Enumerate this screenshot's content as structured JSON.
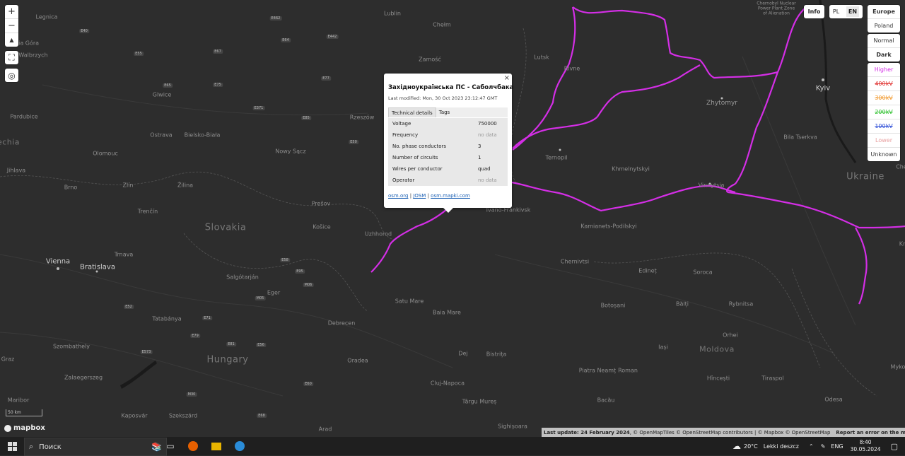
{
  "map": {
    "countries": {
      "slovakia": "Slovakia",
      "hungary": "Hungary",
      "ukraine": "Ukraine",
      "moldova": "Moldova",
      "czechia": "echia"
    },
    "cities": {
      "legnica": "Legnica",
      "walbrzych": "Walbrzych",
      "jelenia": "elenia Góra",
      "lublin": "Lublin",
      "chelm": "Chełm",
      "zamosc": "Zamość",
      "lutsk": "Lutsk",
      "rivne": "Rivne",
      "kyiv": "Kyiv",
      "zhytomyr": "Zhytomyr",
      "bila": "Bila Tserkva",
      "ternopil": "Ternopil",
      "khmel": "Khmelnytskyi",
      "vinnytsia": "Vinnytsia",
      "ivano": "Ivano-Frankivsk",
      "kamianets": "Kamianets-Podilskyi",
      "chernivtsi": "Chernivtsi",
      "edinet": "Edineț",
      "soroca": "Soroca",
      "balti": "Bălți",
      "rybnitsa": "Rybnitsa",
      "botosani": "Botoșani",
      "orhei": "Orhei",
      "iasi": "Iași",
      "hincesti": "Hîncești",
      "tiraspol": "Tiraspol",
      "odesa": "Odesa",
      "piatra": "Piatra Neamț",
      "roman": "Roman",
      "bacau": "Bacău",
      "targu": "Târgu Mureș",
      "sighisoara": "Sighișoara",
      "cluj": "Cluj-Napoca",
      "bistrita": "Bistrița",
      "dej": "Dej",
      "oradea": "Oradea",
      "satu": "Satu Mare",
      "baia": "Baia Mare",
      "debrecen": "Debrecen",
      "eger": "Eger",
      "salgotarjan": "Salgótarján",
      "miskolc": "Košice",
      "presov": "Prešov",
      "uzhhorod": "Uzhhorod",
      "nowy": "Nowy Sącz",
      "rzeszow": "Rzeszów",
      "glivice": "Glwice",
      "ostrava": "Ostrava",
      "bielsko": "Bielsko-Biała",
      "olomouc": "Olomouc",
      "pardubice": "Pardubice",
      "jihlava": "Jihlava",
      "brno": "Brno",
      "zlin": "Zlín",
      "zilina": "Žilina",
      "trencin": "Trenčín",
      "trnava": "Trnava",
      "vienna": "Vienna",
      "bratislava": "Bratislava",
      "tatabanya": "Tatabánya",
      "szombathely": "Szombathely",
      "zalaeg": "Zalaegerszeg",
      "kaposvar": "Kaposvár",
      "szekszard": "Szekszárd",
      "maribor": "Maribor",
      "graz": "Graz",
      "arad": "Arad",
      "chernobyl": "Chernobyl Nuclear Power Plant Zone of Alienation",
      "krop": "Kr",
      "myko": "Myko",
      "ches": "Che"
    },
    "shields": [
      "E40",
      "E55",
      "E67",
      "E65",
      "E75",
      "E371",
      "E77",
      "E85",
      "E50",
      "E58",
      "M06",
      "M05",
      "E81",
      "E71",
      "E79",
      "E60",
      "E68",
      "E573",
      "E52",
      "E56",
      "M30",
      "E95",
      "E64",
      "E442",
      "E462"
    ]
  },
  "controls": {
    "zoom_in": "+",
    "zoom_out": "−",
    "compass": "▲",
    "fullscreen": "⛶",
    "locate": "◎"
  },
  "top_right": {
    "info": "Info",
    "lang_pl": "PL",
    "lang_en": "EN"
  },
  "region_panel": [
    "Europe",
    "Poland"
  ],
  "style_panel": [
    "Normal",
    "Dark"
  ],
  "legend_panel": [
    {
      "label": "Higher",
      "color": "#d42ee6",
      "strike": false
    },
    {
      "label": "400kV",
      "color": "#e0302e",
      "strike": true
    },
    {
      "label": "300kV",
      "color": "#f29a2e",
      "strike": true
    },
    {
      "label": "200kV",
      "color": "#2fc12f",
      "strike": true
    },
    {
      "label": "100kV",
      "color": "#3050d8",
      "strike": true
    },
    {
      "label": "Lower",
      "color": "#e8a0a0",
      "strike": false
    },
    {
      "label": "Unknown",
      "color": "#333333",
      "strike": false
    }
  ],
  "popup": {
    "close": "×",
    "title": "Західноукраїнська ПС - Саболчбака",
    "modified": "Last modified: Mon, 30 Oct 2023 23:12:47 GMT",
    "tab_tech": "Technical details",
    "tab_tags": "Tags",
    "rows": [
      {
        "k": "Voltage",
        "v": "750000"
      },
      {
        "k": "Frequency",
        "v": "no data"
      },
      {
        "k": "No. phase conductors",
        "v": "3"
      },
      {
        "k": "Number of circuits",
        "v": "1"
      },
      {
        "k": "Wires per conductor",
        "v": "quad"
      },
      {
        "k": "Operator",
        "v": "no data"
      }
    ],
    "link_osm": "osm.org",
    "sep1": " | ",
    "link_josm": "JOSM",
    "sep2": " | ",
    "link_mapki": "osm.mapki.com"
  },
  "attribution": {
    "last_update": "Last update: 24 February 2024",
    "credits": ", © OpenMapTiles © OpenStreetMap contributors | © Mapbox © OpenStreetMap",
    "report": "Report an error on the map"
  },
  "scale": "50 km",
  "logo": "mapbox",
  "taskbar": {
    "search_placeholder": "Поиск",
    "weather": "20°C",
    "weather_desc": "Lekki deszcz",
    "lang": "ENG",
    "time": "8:40",
    "date": "30.05.2024"
  }
}
